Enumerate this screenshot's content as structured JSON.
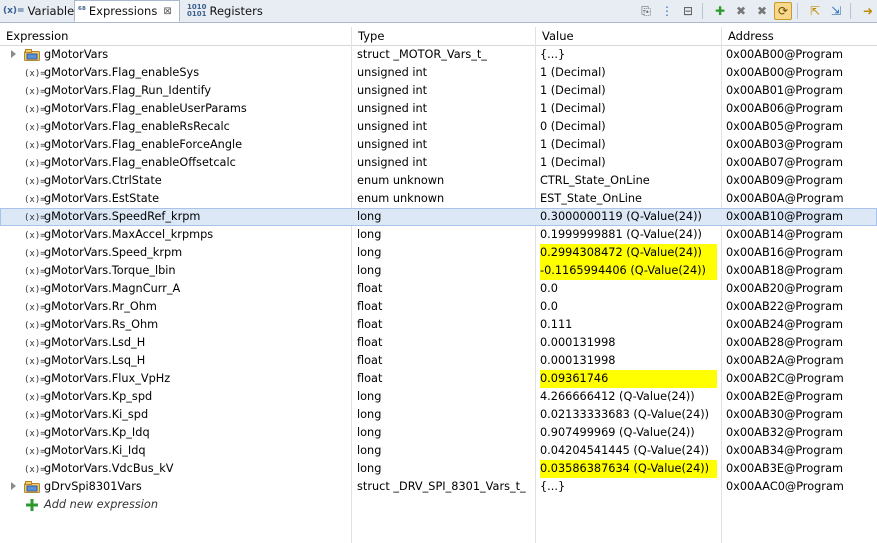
{
  "tabs": [
    {
      "label": "Variables",
      "icon": "variables-icon",
      "icon_glyph": "(x)="
    },
    {
      "label": "Expressions",
      "icon": "expressions-icon",
      "icon_glyph": "⁶⁸",
      "close": "⊠"
    },
    {
      "label": "Registers",
      "icon": "registers-icon",
      "icon_glyph": "1010\n0101"
    }
  ],
  "columns": [
    "Expression",
    "Type",
    "Value",
    "Address"
  ],
  "rows": [
    {
      "expr": "gMotorVars",
      "type": "struct _MOTOR_Vars_t_",
      "value": "{...}",
      "address": "0x00AB00@Program",
      "kind": "struct",
      "expandable": true
    },
    {
      "expr": "gMotorVars.Flag_enableSys",
      "type": "unsigned int",
      "value": "1 (Decimal)",
      "address": "0x00AB00@Program",
      "kind": "var"
    },
    {
      "expr": "gMotorVars.Flag_Run_Identify",
      "type": "unsigned int",
      "value": "1 (Decimal)",
      "address": "0x00AB01@Program",
      "kind": "var"
    },
    {
      "expr": "gMotorVars.Flag_enableUserParams",
      "type": "unsigned int",
      "value": "1 (Decimal)",
      "address": "0x00AB06@Program",
      "kind": "var"
    },
    {
      "expr": "gMotorVars.Flag_enableRsRecalc",
      "type": "unsigned int",
      "value": "0 (Decimal)",
      "address": "0x00AB05@Program",
      "kind": "var"
    },
    {
      "expr": "gMotorVars.Flag_enableForceAngle",
      "type": "unsigned int",
      "value": "1 (Decimal)",
      "address": "0x00AB03@Program",
      "kind": "var"
    },
    {
      "expr": "gMotorVars.Flag_enableOffsetcalc",
      "type": "unsigned int",
      "value": "1 (Decimal)",
      "address": "0x00AB07@Program",
      "kind": "var"
    },
    {
      "expr": "gMotorVars.CtrlState",
      "type": "enum unknown",
      "value": "CTRL_State_OnLine",
      "address": "0x00AB09@Program",
      "kind": "var"
    },
    {
      "expr": "gMotorVars.EstState",
      "type": "enum unknown",
      "value": "EST_State_OnLine",
      "address": "0x00AB0A@Program",
      "kind": "var"
    },
    {
      "expr": "gMotorVars.SpeedRef_krpm",
      "type": "long",
      "value": "0.3000000119 (Q-Value(24))",
      "address": "0x00AB10@Program",
      "kind": "var",
      "selected": true
    },
    {
      "expr": "gMotorVars.MaxAccel_krpmps",
      "type": "long",
      "value": "0.1999999881 (Q-Value(24))",
      "address": "0x00AB14@Program",
      "kind": "var"
    },
    {
      "expr": "gMotorVars.Speed_krpm",
      "type": "long",
      "value": "0.2994308472 (Q-Value(24))",
      "address": "0x00AB16@Program",
      "kind": "var",
      "changed": true
    },
    {
      "expr": "gMotorVars.Torque_lbin",
      "type": "long",
      "value": "-0.1165994406 (Q-Value(24))",
      "address": "0x00AB18@Program",
      "kind": "var",
      "changed": true
    },
    {
      "expr": "gMotorVars.MagnCurr_A",
      "type": "float",
      "value": "0.0",
      "address": "0x00AB20@Program",
      "kind": "var"
    },
    {
      "expr": "gMotorVars.Rr_Ohm",
      "type": "float",
      "value": "0.0",
      "address": "0x00AB22@Program",
      "kind": "var"
    },
    {
      "expr": "gMotorVars.Rs_Ohm",
      "type": "float",
      "value": "0.111",
      "address": "0x00AB24@Program",
      "kind": "var"
    },
    {
      "expr": "gMotorVars.Lsd_H",
      "type": "float",
      "value": "0.000131998",
      "address": "0x00AB28@Program",
      "kind": "var"
    },
    {
      "expr": "gMotorVars.Lsq_H",
      "type": "float",
      "value": "0.000131998",
      "address": "0x00AB2A@Program",
      "kind": "var"
    },
    {
      "expr": "gMotorVars.Flux_VpHz",
      "type": "float",
      "value": "0.09361746",
      "address": "0x00AB2C@Program",
      "kind": "var",
      "changed": true
    },
    {
      "expr": "gMotorVars.Kp_spd",
      "type": "long",
      "value": "4.266666412 (Q-Value(24))",
      "address": "0x00AB2E@Program",
      "kind": "var"
    },
    {
      "expr": "gMotorVars.Ki_spd",
      "type": "long",
      "value": "0.02133333683 (Q-Value(24))",
      "address": "0x00AB30@Program",
      "kind": "var"
    },
    {
      "expr": "gMotorVars.Kp_Idq",
      "type": "long",
      "value": "0.907499969 (Q-Value(24))",
      "address": "0x00AB32@Program",
      "kind": "var"
    },
    {
      "expr": "gMotorVars.Ki_Idq",
      "type": "long",
      "value": "0.04204541445 (Q-Value(24))",
      "address": "0x00AB34@Program",
      "kind": "var"
    },
    {
      "expr": "gMotorVars.VdcBus_kV",
      "type": "long",
      "value": "0.03586387634 (Q-Value(24))",
      "address": "0x00AB3E@Program",
      "kind": "var",
      "changed": true
    },
    {
      "expr": "gDrvSpi8301Vars",
      "type": "struct _DRV_SPI_8301_Vars_t_",
      "value": "{...}",
      "address": "0x00AAC0@Program",
      "kind": "struct",
      "expandable": true
    }
  ],
  "add_expression": "Add new expression",
  "var_icon_glyph": "(x)=",
  "colors": {
    "changed": "#ffff00",
    "selected": "#dde8f7",
    "tab_bar": "#e8edf4"
  }
}
